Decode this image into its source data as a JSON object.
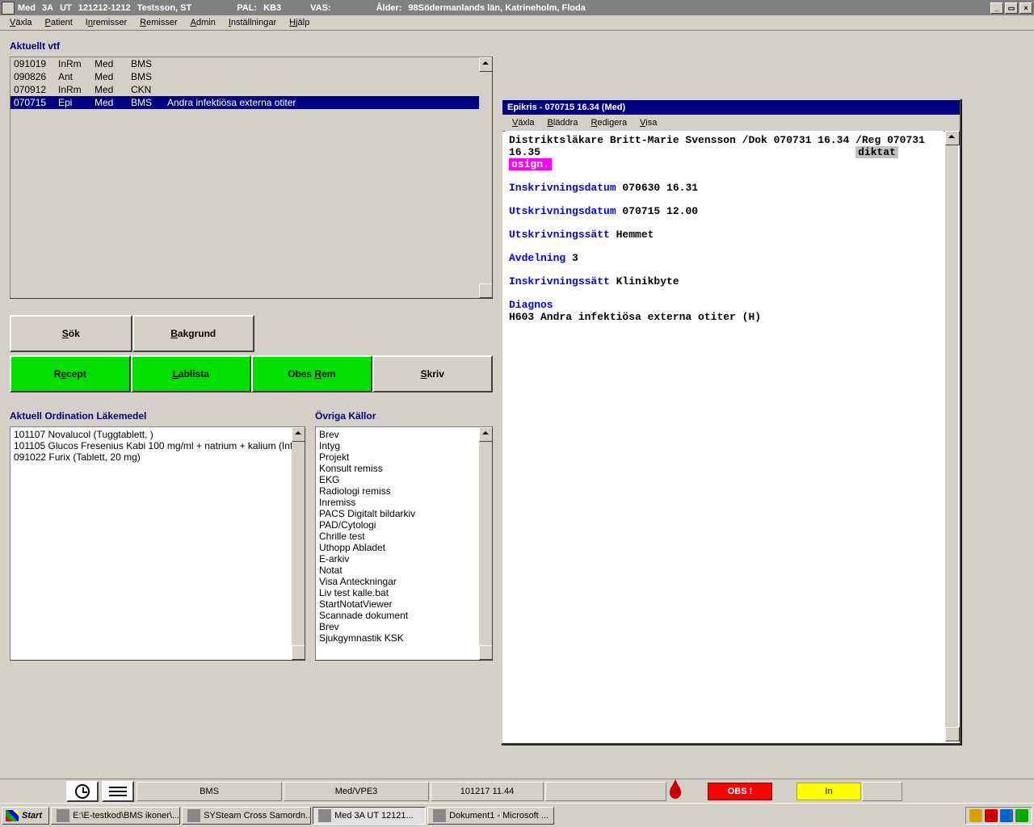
{
  "titlebar": {
    "app": "Med",
    "ward": "3A",
    "ut": "UT",
    "ssn": "121212-1212",
    "name": "Testsson, ST",
    "pal_label": "PAL:",
    "pal": "KB3",
    "vas_label": "VAS:",
    "age_label": "Ålder:",
    "age": "98",
    "region": "Södermanlands län, Katrineholm, Floda"
  },
  "menubar": [
    "Växla",
    "Patient",
    "Inremisser",
    "Remisser",
    "Admin",
    "Inställningar",
    "Hjälp"
  ],
  "vtf": {
    "title": "Aktuellt vtf",
    "rows": [
      {
        "date": "091019",
        "c2": "InRm",
        "c3": "Med",
        "c4": "BMS",
        "c5": "",
        "sel": false
      },
      {
        "date": "090826",
        "c2": "Ant",
        "c3": "Med",
        "c4": "BMS",
        "c5": "",
        "sel": false
      },
      {
        "date": "070912",
        "c2": "InRm",
        "c3": "Med",
        "c4": "CKN",
        "c5": "",
        "sel": false
      },
      {
        "date": "070715",
        "c2": "Epi",
        "c3": "Med",
        "c4": "BMS",
        "c5": "Andra infektiösa externa otiter",
        "sel": true
      }
    ]
  },
  "buttons": {
    "sok": "Sök",
    "bakgrund": "Bakgrund",
    "recept": "Recept",
    "lablista": "Lablista",
    "obesrem": "Obes Rem",
    "skriv": "Skriv"
  },
  "ordination": {
    "title": "Aktuell Ordination Läkemedel",
    "rows": [
      "101107 Novalucol (Tuggtablett, )",
      "101105 Glucos Fresenius Kabi 100 mg/ml + natrium + kalium (Inf",
      "091022 Furix (Tablett, 20 mg)"
    ]
  },
  "sources": {
    "title": "Övriga Källor",
    "rows": [
      "Brev",
      "Intyg",
      "Projekt",
      "Konsult remiss",
      "EKG",
      "Radiologi remiss",
      "Inremiss",
      "PACS Digitalt bildarkiv",
      "PAD/Cytologi",
      "Chrille test",
      "Uthopp Abladet",
      "E-arkiv",
      "Notat",
      "Visa Anteckningar",
      "Liv test kalle.bat",
      "StartNotatViewer",
      "Scannade dokument",
      "Brev",
      "Sjukgymnastik KSK"
    ]
  },
  "epikris": {
    "title": "Epikris - 070715 16.34  (Med)",
    "menu": [
      "Växla",
      "Bläddra",
      "Redigera",
      "Visa"
    ],
    "header": "Distriktsläkare Britt-Marie Svensson /Dok 070731 16.34 /Reg 070731 16.35",
    "status_diktat": "diktat",
    "status_osign": "osign.",
    "fields": [
      {
        "label": "Inskrivningsdatum",
        "value": "070630 16.31"
      },
      {
        "label": "Utskrivningsdatum",
        "value": "070715 12.00"
      },
      {
        "label": "Utskrivningssätt",
        "value": "Hemmet"
      },
      {
        "label": "Avdelning",
        "value": "3"
      },
      {
        "label": "Inskrivningssätt",
        "value": "Klinikbyte"
      }
    ],
    "diagnos_label": "Diagnos",
    "diagnos": "H603 Andra infektiösa externa otiter (H)"
  },
  "statusbar": {
    "bms": "BMS",
    "medvpe": "Med/VPE3",
    "datetime": "101217  11.44",
    "obs": "OBS !",
    "in": "In"
  },
  "taskbar": {
    "start": "Start",
    "items": [
      {
        "label": "E:\\E-testkod\\BMS ikoner\\...",
        "active": false
      },
      {
        "label": "SYSteam Cross Samordn...",
        "active": false
      },
      {
        "label": "Med   3A   UT   12121...",
        "active": true
      },
      {
        "label": "Dokument1 - Microsoft ...",
        "active": false
      }
    ]
  }
}
